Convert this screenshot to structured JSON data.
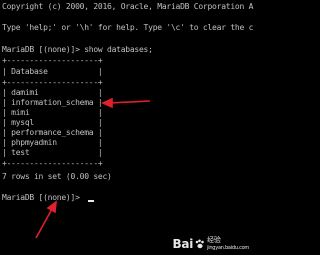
{
  "terminal": {
    "copyright_line": "Copyright (c) 2000, 2016, Oracle, MariaDB Corporation A",
    "help_line": "Type 'help;' or '\\h' for help. Type '\\c' to clear the c",
    "command_line": "MariaDB [(none)]> show databases;",
    "table_border": "+--------------------+",
    "table_header": "| Database           |",
    "rows": [
      "| damimi             |",
      "| information_schema |",
      "| mimi               |",
      "| mysql              |",
      "| performance_schema |",
      "| phpmyadmin         |",
      "| test               |"
    ],
    "result_line": "7 rows in set (0.00 sec)",
    "prompt": "MariaDB [(none)]>"
  },
  "watermark": {
    "brand": "Bai",
    "sub_top": "经验",
    "sub_bottom": "jingyan.baidu.com"
  },
  "colors": {
    "background": "#000000",
    "text": "#c0c0c0",
    "arrow": "#e0202a"
  }
}
